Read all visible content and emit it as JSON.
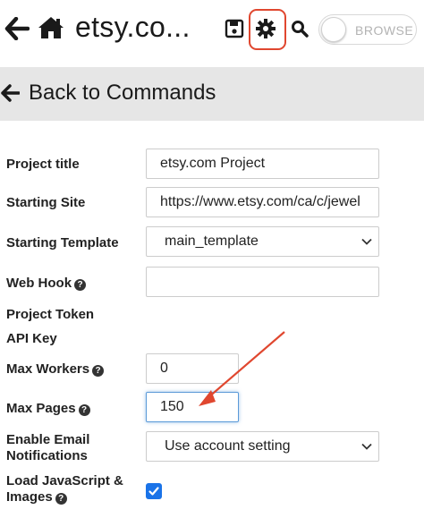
{
  "header": {
    "title": "etsy.co...",
    "icons": {
      "back": "arrow-left-icon",
      "home": "home-icon",
      "save": "floppy-disk-icon",
      "settings": "gear-icon",
      "search": "search-icon"
    },
    "toggle_label": "BROWSE",
    "highlight_color": "#e0472f"
  },
  "backbar": {
    "label": "Back to Commands"
  },
  "form": {
    "project_title": {
      "label": "Project title",
      "value": "etsy.com Project"
    },
    "starting_site": {
      "label": "Starting Site",
      "value": "https://www.etsy.com/ca/c/jewel"
    },
    "starting_template": {
      "label": "Starting Template",
      "value": "main_template"
    },
    "web_hook": {
      "label": "Web Hook",
      "value": ""
    },
    "project_token": {
      "label": "Project Token"
    },
    "api_key": {
      "label": "API Key"
    },
    "max_workers": {
      "label": "Max Workers",
      "value": "0"
    },
    "max_pages": {
      "label": "Max Pages",
      "value": "150"
    },
    "email_notifications": {
      "label_line1": "Enable Email",
      "label_line2": "Notifications",
      "value": "Use account setting"
    },
    "load_js": {
      "label_line1": "Load JavaScript &",
      "label_line2": "Images",
      "checked": true
    }
  },
  "colors": {
    "accent_blue": "#1a73e8",
    "annotation_red": "#e0472f"
  }
}
